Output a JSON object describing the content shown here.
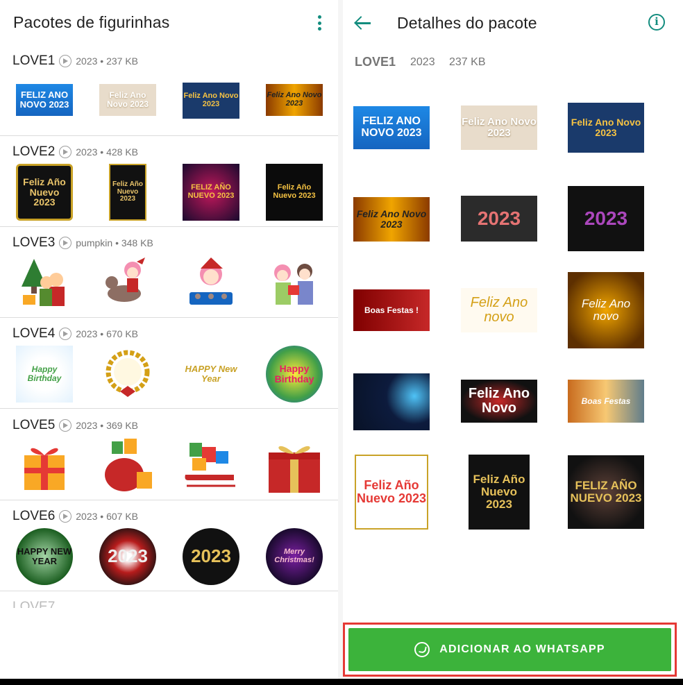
{
  "left_panel": {
    "title": "Pacotes de figurinhas",
    "packs": [
      {
        "name": "LOVE1",
        "meta": "2023 • 237 KB",
        "stickers": [
          "FELIZ ANO NOVO 2023",
          "Feliz Ano Novo 2023",
          "Feliz Ano Novo 2023",
          "Feliz Ano Novo 2023"
        ]
      },
      {
        "name": "LOVE2",
        "meta": "2023 • 428 KB",
        "stickers": [
          "Feliz Año Nuevo 2023",
          "Feliz Año Nuevo 2023",
          "FELIZ AÑO NUEVO 2023",
          "Feliz Año Nuevo 2023"
        ]
      },
      {
        "name": "LOVE3",
        "meta": "pumpkin • 348 KB",
        "stickers": []
      },
      {
        "name": "LOVE4",
        "meta": "2023 • 670 KB",
        "stickers": [
          "Happy Birthday",
          "",
          "HAPPY New Year",
          "Happy Birthday"
        ]
      },
      {
        "name": "LOVE5",
        "meta": "2023 • 369 KB",
        "stickers": []
      },
      {
        "name": "LOVE6",
        "meta": "2023 • 607 KB",
        "stickers": [
          "HAPPY NEW YEAR",
          "2023",
          "2023",
          "Merry Christmas!"
        ]
      }
    ],
    "partial_item": "LOVE7"
  },
  "right_panel": {
    "title": "Detalhes do pacote",
    "pack_name": "LOVE1",
    "publisher": "2023",
    "size": "237 KB",
    "stickers": [
      "FELIZ ANO NOVO 2023",
      "Feliz Ano Novo 2023",
      "Feliz Ano Novo 2023",
      "Feliz Ano Novo 2023",
      "2023",
      "2023",
      "Boas Festas !",
      "Feliz Ano novo",
      "Feliz Ano novo",
      "",
      "Feliz Ano Novo",
      "Boas Festas",
      "Feliz Año Nuevo 2023",
      "Feliz Año Nuevo 2023",
      "FELIZ AÑO NUEVO 2023"
    ],
    "add_button_label": "ADICIONAR AO WHATSAPP"
  },
  "colors": {
    "accent": "#128c7e",
    "button": "#3cb33b",
    "highlight": "#e53935"
  }
}
